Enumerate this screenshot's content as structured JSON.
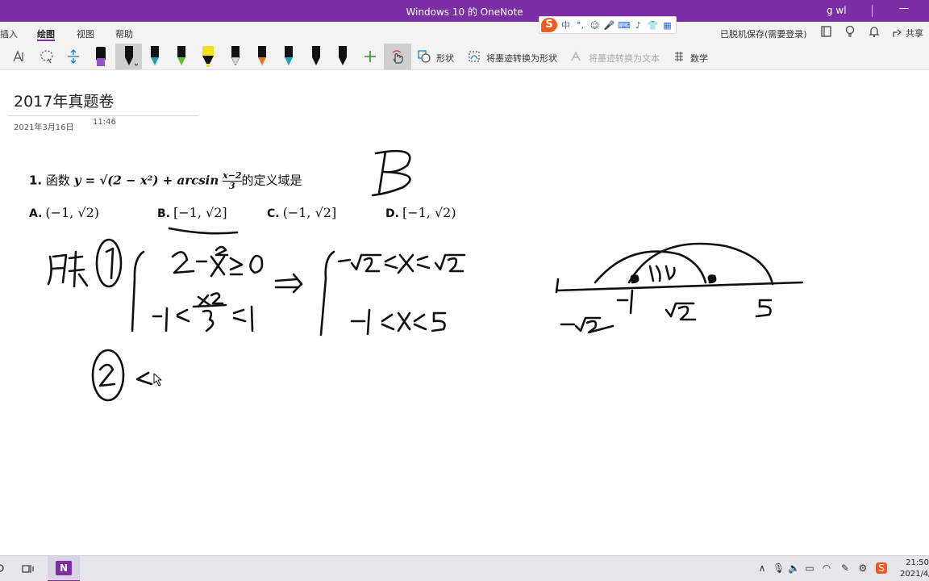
{
  "window": {
    "title": "Windows 10 的 OneNote",
    "user": "g wl",
    "minimize": "—"
  },
  "tabs": [
    {
      "label": "插入"
    },
    {
      "label": "绘图"
    },
    {
      "label": "视图"
    },
    {
      "label": "帮助"
    }
  ],
  "header": {
    "saved_status": "已脱机保存(需要登录)",
    "share_label": "共享"
  },
  "ime": {
    "logo": "S",
    "items": [
      "中",
      "°,",
      "☺",
      "🎤",
      "⌨",
      "♪",
      "👕",
      "▦"
    ]
  },
  "toolbar": {
    "shapes_label": "形状",
    "ink_to_shape_label": "将墨迹转换为形状",
    "ink_to_text_label": "将墨迹转换为文本",
    "math_label": "数学",
    "pens": [
      {
        "name": "pen-purple",
        "color": "#9b4fd0"
      },
      {
        "name": "pen-black-selected",
        "color": "#111111"
      },
      {
        "name": "pen-teal",
        "color": "#1aa3b8"
      },
      {
        "name": "pen-green",
        "color": "#5fbf2a"
      },
      {
        "name": "highlighter-yellow",
        "color": "#f2e21a"
      },
      {
        "name": "pen-pencil-gray",
        "color": "#6d6d6d"
      },
      {
        "name": "pen-orange",
        "color": "#e07a1f"
      },
      {
        "name": "pen-cyan",
        "color": "#1aa3b8"
      },
      {
        "name": "pen-black-2",
        "color": "#111111"
      },
      {
        "name": "pen-black-3",
        "color": "#111111"
      }
    ]
  },
  "page": {
    "title": "2017年真题卷",
    "date": "2021年3月16日",
    "time": "11:46",
    "question": {
      "number": "1.",
      "text_before": "函数",
      "formula": "y = √(2 − x²) + arcsin",
      "frac_num": "x−2",
      "frac_den": "3",
      "text_after": "的定义域是"
    },
    "options": [
      {
        "label": "A.",
        "value": "(−1, √2)"
      },
      {
        "label": "B.",
        "value": "[−1, √2]"
      },
      {
        "label": "C.",
        "value": "(−1, √2]"
      },
      {
        "label": "D.",
        "value": "[−1, √2)"
      }
    ]
  },
  "taskbar": {
    "time": "21:50",
    "date": "2021/4/"
  }
}
